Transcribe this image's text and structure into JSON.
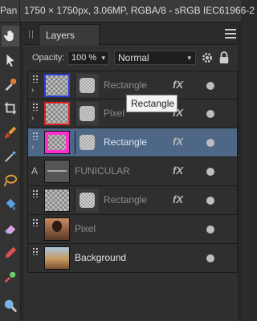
{
  "topbar": {
    "tool_label": "Pan",
    "doc_info": "1750 × 1750px, 3.06MP, RGBA/8 - sRGB IEC61966-2"
  },
  "panel": {
    "tab_label": "Layers",
    "opacity_label": "Opacity:",
    "opacity_value": "100 %",
    "blend_mode": "Normal"
  },
  "layers": [
    {
      "name": "Rectangle",
      "thumb": "blue-rect",
      "has_mask": true,
      "fx": "fX",
      "selected": false
    },
    {
      "name": "Pixel",
      "thumb": "red-rect",
      "has_mask": true,
      "fx": "fX",
      "selected": false
    },
    {
      "name": "Rectangle",
      "thumb": "magenta-rect",
      "has_mask": true,
      "fx": "fX",
      "selected": true
    },
    {
      "name": "FUNICULAR",
      "thumb": "text",
      "has_mask": false,
      "fx": "fX",
      "selected": false
    },
    {
      "name": "Rectangle",
      "thumb": "transparent",
      "has_mask": true,
      "fx": "fX",
      "selected": false
    },
    {
      "name": "Pixel",
      "thumb": "photo-woman",
      "has_mask": false,
      "fx": "",
      "selected": false
    },
    {
      "name": "Background",
      "thumb": "photo-landscape",
      "has_mask": false,
      "fx": "",
      "selected": false
    }
  ],
  "tooltip": "Rectangle",
  "colors": {
    "selected_row": "#4f6786",
    "panel_bg": "#303030",
    "toolbar_bg": "#333333"
  },
  "icons": [
    "hand-icon",
    "move-icon",
    "color-picker-icon",
    "crop-icon",
    "paint-brush-icon",
    "magic-wand-icon",
    "selection-brush-icon",
    "fill-bucket-icon",
    "eraser-icon",
    "pencil-icon",
    "healing-icon",
    "zoom-icon"
  ]
}
